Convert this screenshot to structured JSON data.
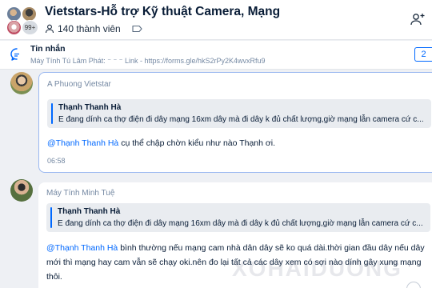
{
  "header": {
    "avatar_overflow": "99+",
    "title": "Vietstars-Hỗ trợ Kỹ thuật Camera, Mạng",
    "member_count": "140 thành viên"
  },
  "pinned": {
    "title": "Tin nhắn",
    "preview": "Máy Tính Tú Lâm Phát: ⁻ ⁻ ⁻  Link - https://forms.gle/hkS2rPy2K4wvxRfu9",
    "count": "2"
  },
  "messages": [
    {
      "sender": "A Phuong Vietstar",
      "quote_name": "Thạnh Thanh Hà",
      "quote_text": "E đang dính ca thợ điện đi dây mạng 16xm dây mà đi dây k đủ chất lượng,giờ mạng lẫn camera cứ c...",
      "mention": "@Thạnh Thanh Hà",
      "text": " cụ thể chập chờn kiểu như nào Thạnh ơi.",
      "time": "06:58"
    },
    {
      "sender": "Máy Tính Minh Tuệ",
      "quote_name": "Thạnh Thanh Hà",
      "quote_text": "E đang dính ca thợ điện đi dây mạng 16xm dây mà đi dây k đủ chất lượng,giờ mạng lẫn camera cứ c...",
      "mention": "@Thạnh Thanh Hà",
      "text": " bình thường nếu mạng cam nhà dân dây sẽ ko quá dài.thời gian đầu dây nếu dây mới thì mạng hay cam vẫn sẽ chạy oki.nên đo lại tất cả các dây xem có sợi nào dính gây xung mạng thôi."
    }
  ],
  "watermark": "XOHAIDUONG",
  "colors": {
    "accent": "#0068ff",
    "text": "#081c36",
    "muted": "#7589a3",
    "background": "#eef0f4"
  }
}
